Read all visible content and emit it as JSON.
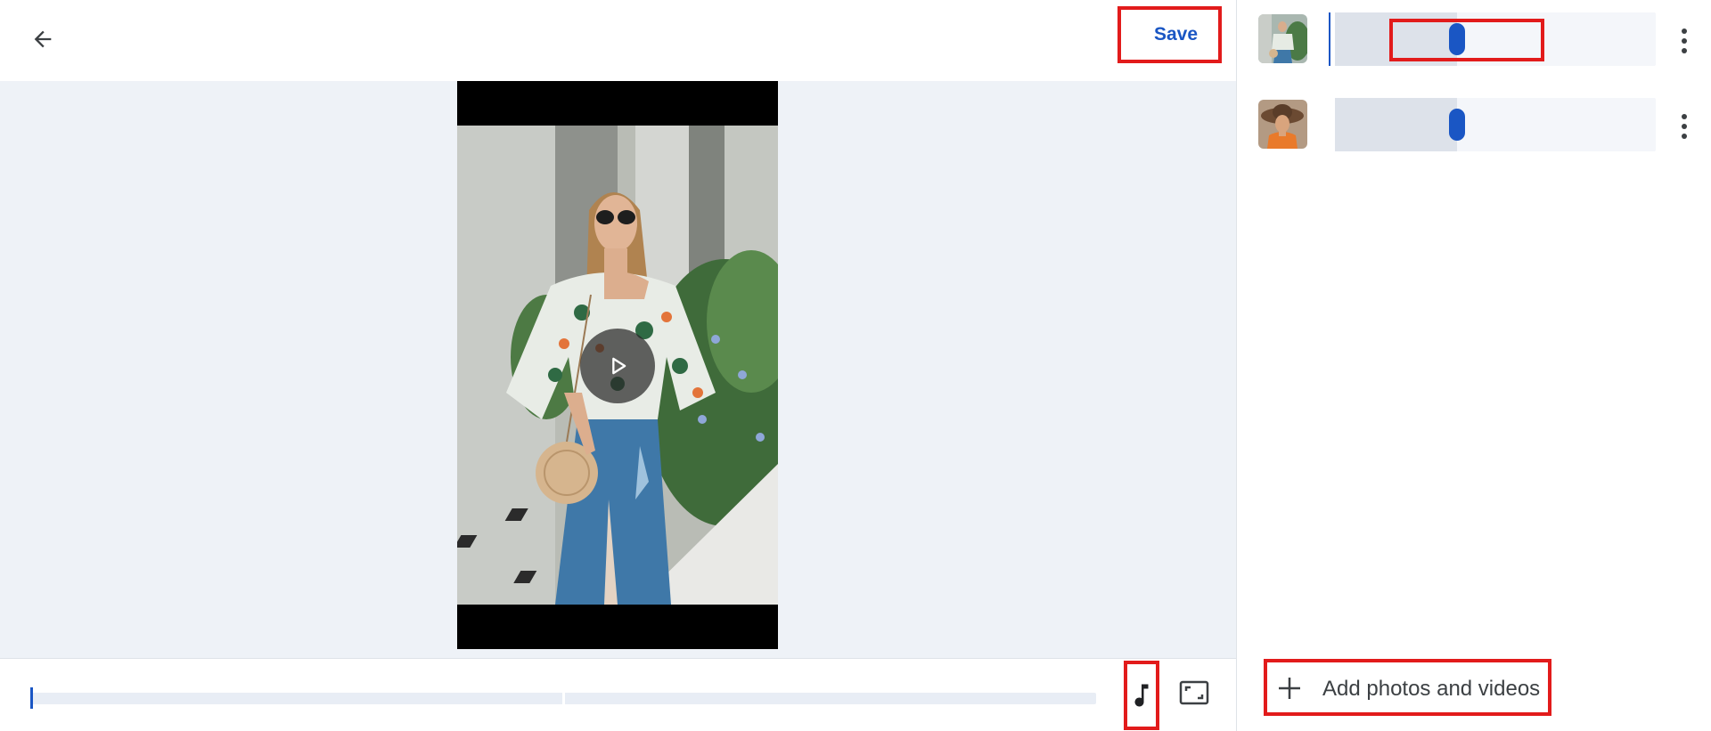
{
  "toolbar": {
    "back_icon": "arrow-left-icon",
    "save_label": "Save"
  },
  "preview": {
    "play_icon": "play-icon",
    "photo_description_icon": "woman-in-floral-shirt-photo"
  },
  "timeline": {
    "music_icon": "music-note-icon",
    "aspect_icon": "aspect-ratio-icon"
  },
  "clips": [
    {
      "thumb": "clip-1-thumbnail",
      "trim_fraction": 0.38,
      "menu_icon": "more-vert-icon"
    },
    {
      "thumb": "clip-2-thumbnail",
      "trim_fraction": 0.38,
      "menu_icon": "more-vert-icon"
    }
  ],
  "add_media": {
    "icon": "plus-icon",
    "label": "Add photos and videos"
  },
  "colors": {
    "accent": "#1a56c4",
    "highlight": "#e21b1b",
    "preview_bg": "#eef2f7"
  }
}
